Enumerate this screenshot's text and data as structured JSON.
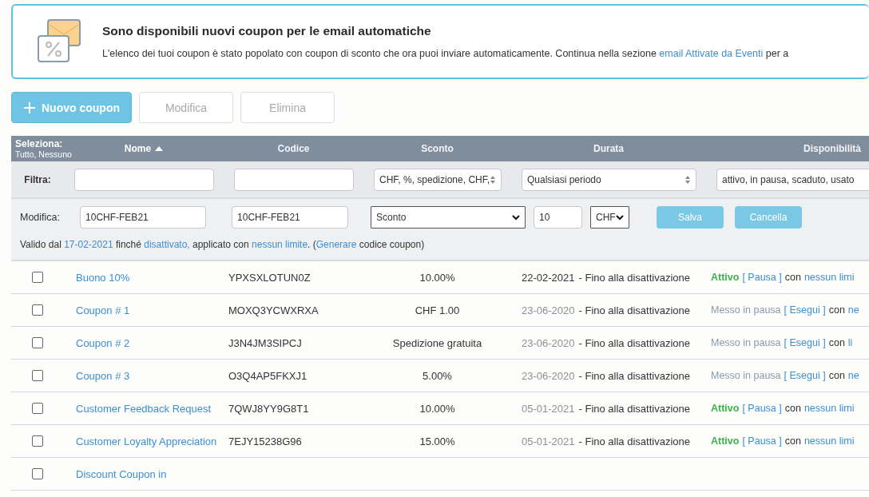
{
  "banner": {
    "title": "Sono disponibili nuovi coupon per le email automatiche",
    "text_before": "L'elenco dei tuoi coupon è stato popolato con coupon di sconto che ora puoi inviare automaticamente. Continua nella sezione",
    "link": "email Attivate da Eventi",
    "text_after": "per a"
  },
  "toolbar": [
    {
      "label": "Nuovo coupon",
      "kind": "primary",
      "disabled": false
    },
    {
      "label": "Modifica",
      "kind": "plain",
      "disabled": true
    },
    {
      "label": "Elimina",
      "kind": "plain",
      "disabled": true
    }
  ],
  "table": {
    "select_label": "Seleziona:",
    "select_links": "Tutto, Nessuno",
    "columns": [
      {
        "label": "Nome",
        "sorted": true
      },
      {
        "label": "Codice",
        "sorted": false
      },
      {
        "label": "Sconto",
        "sorted": false
      },
      {
        "label": "Durata",
        "sorted": false
      },
      {
        "label": "Disponibilità",
        "sorted": false
      }
    ],
    "filter": {
      "label": "Filtra:",
      "discount": "CHF, %, spedizione, CHF,",
      "period": "Qualsiasi periodo",
      "availability": "attivo, in pausa, scaduto, usato"
    },
    "edit": {
      "label": "Modifica:",
      "name": "10CHF-FEB21",
      "code": "10CHF-FEB21",
      "type": "Sconto",
      "amount": "10",
      "currency": "CHF",
      "save": "Salva",
      "cancel": "Cancella",
      "description": [
        {
          "kind": "text",
          "text": "Valido dal"
        },
        {
          "kind": "link",
          "text": "17-02-2021"
        },
        {
          "kind": "text",
          "text": "finché"
        },
        {
          "kind": "link",
          "text": "disattivato,"
        },
        {
          "kind": "text",
          "text": "applicato con"
        },
        {
          "kind": "link",
          "text": "nessun limite"
        },
        {
          "kind": "text",
          "text": ". ("
        },
        {
          "kind": "link",
          "text": "Generare"
        },
        {
          "kind": "text",
          "text": "codice coupon)"
        }
      ]
    },
    "rows": [
      {
        "checked": false,
        "name": "Buono 10%",
        "code": "YPXSXLOTUN0Z",
        "discount": "10.00%",
        "date": "22-02-2021",
        "date_past": false,
        "until": "- Fino alla disattivazione",
        "kind": "active",
        "status_text": "Attivo",
        "action": "[ Pausa ]",
        "con": "con",
        "limit": "nessun limi"
      },
      {
        "checked": false,
        "name": "Coupon # 1",
        "code": "MOXQ3YCWXRXA",
        "discount": "CHF 1.00",
        "date": "23-06-2020",
        "date_past": true,
        "until": "- Fino alla disattivazione",
        "kind": "paused",
        "status_text": "Messo in pausa",
        "action": "[ Esegui ]",
        "con": "con",
        "limit": "ne"
      },
      {
        "checked": false,
        "name": "Coupon # 2",
        "code": "J3N4JM3SIPCJ",
        "discount": "Spedizione gratuita",
        "date": "23-06-2020",
        "date_past": true,
        "until": "- Fino alla disattivazione",
        "kind": "paused",
        "status_text": "Messo in pausa",
        "action": "[ Esegui ]",
        "con": "con",
        "limit": "li"
      },
      {
        "checked": false,
        "name": "Coupon # 3",
        "code": "O3Q4AP5FKXJ1",
        "discount": "5.00%",
        "date": "23-06-2020",
        "date_past": true,
        "until": "- Fino alla disattivazione",
        "kind": "paused",
        "status_text": "Messo in pausa",
        "action": "[ Esegui ]",
        "con": "con",
        "limit": "ne"
      },
      {
        "checked": false,
        "name": "Customer Feedback Request",
        "code": "7QWJ8YY9G8T1",
        "discount": "10.00%",
        "date": "05-01-2021",
        "date_past": true,
        "until": "- Fino alla disattivazione",
        "kind": "active",
        "status_text": "Attivo",
        "action": "[ Pausa ]",
        "con": "con",
        "limit": "nessun limi"
      },
      {
        "checked": false,
        "name": "Customer Loyalty Appreciation",
        "code": "7EJY15238G96",
        "discount": "15.00%",
        "date": "05-01-2021",
        "date_past": true,
        "until": "- Fino alla disattivazione",
        "kind": "active",
        "status_text": "Attivo",
        "action": "[ Pausa ]",
        "con": "con",
        "limit": "nessun limi"
      },
      {
        "checked": false,
        "name": "Discount Coupon in"
      }
    ]
  }
}
